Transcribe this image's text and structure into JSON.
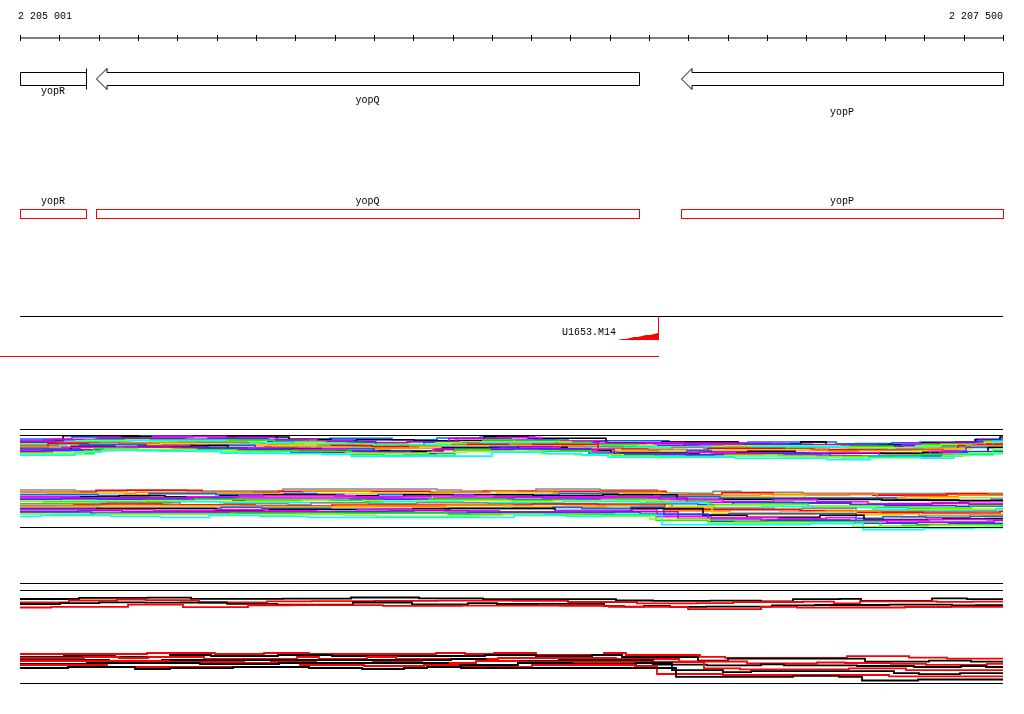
{
  "ruler": {
    "start_label": "2 205 001",
    "end_label": "2 207 500"
  },
  "gene_track": {
    "genes": [
      {
        "name": "yopR",
        "kind": "truncated"
      },
      {
        "name": "yopQ",
        "kind": "arrow"
      },
      {
        "name": "yopP",
        "kind": "arrow"
      }
    ]
  },
  "feature_track": {
    "features": [
      {
        "name": "yopR"
      },
      {
        "name": "yopQ"
      },
      {
        "name": "yopP"
      }
    ]
  },
  "read_track": {
    "label": "U1653.M14"
  }
}
